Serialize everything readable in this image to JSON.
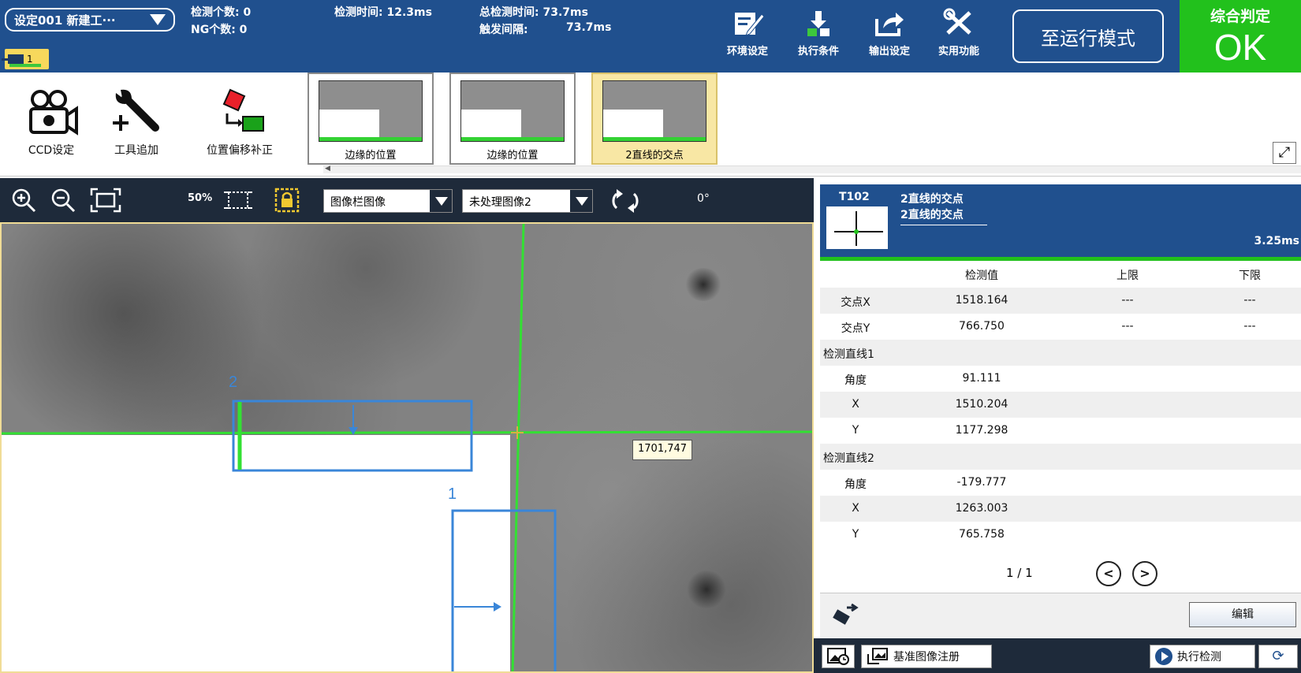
{
  "header": {
    "setting_select": "设定001 新建工···",
    "detect_count": "检测个数: 0",
    "ng_count": "NG个数:   0",
    "detect_time": "检测时间: 12.3ms",
    "total_time": "总检测时间: 73.7ms",
    "trigger_interval_label": "触发间隔:",
    "trigger_interval_value": "73.7ms",
    "camera_badge": "1",
    "tools": [
      {
        "label": "环境设定",
        "icon": "edit-icon"
      },
      {
        "label": "执行条件",
        "icon": "run-condition-icon"
      },
      {
        "label": "输出设定",
        "icon": "export-icon"
      },
      {
        "label": "实用功能",
        "icon": "tools-icon"
      }
    ],
    "run_mode_button": "至运行模式",
    "judge_label": "综合判定",
    "judge_value": "OK",
    "judge_color": "#22c11c"
  },
  "toolstrip": {
    "ccd": "CCD设定",
    "add_tool": "工具追加",
    "offset": "位置偏移补正",
    "thumbnails": [
      {
        "label": "边缘的位置",
        "active": false
      },
      {
        "label": "边缘的位置",
        "active": false
      },
      {
        "label": "2直线的交点",
        "active": true
      }
    ]
  },
  "imagebar": {
    "zoom": "50%",
    "image_source": "图像栏图像",
    "image_type": "未处理图像2",
    "angle": "0°"
  },
  "viewport": {
    "tooltip": "1701,747",
    "roi_labels": [
      "2",
      "1"
    ]
  },
  "panel": {
    "tool_id": "T102",
    "tool_name": "2直线的交点",
    "tool_subname": "2直线的交点",
    "time": "3.25ms",
    "headers": {
      "value": "检测值",
      "upper": "上限",
      "lower": "下限"
    },
    "rows": [
      {
        "name": "交点X",
        "value": "1518.164",
        "upper": "---",
        "lower": "---"
      },
      {
        "name": "交点Y",
        "value": "766.750",
        "upper": "---",
        "lower": "---"
      },
      {
        "group": "检测直线1"
      },
      {
        "name": "角度",
        "value": "91.111"
      },
      {
        "name": "X",
        "value": "1510.204"
      },
      {
        "name": "Y",
        "value": "1177.298"
      },
      {
        "group": "检测直线2"
      },
      {
        "name": "角度",
        "value": "-179.777"
      },
      {
        "name": "X",
        "value": "1263.003"
      },
      {
        "name": "Y",
        "value": "765.758"
      }
    ],
    "pager": "1 / 1",
    "edit_button": "编辑"
  },
  "footer": {
    "register_button": "基准图像注册",
    "run_button": "执行检测"
  }
}
